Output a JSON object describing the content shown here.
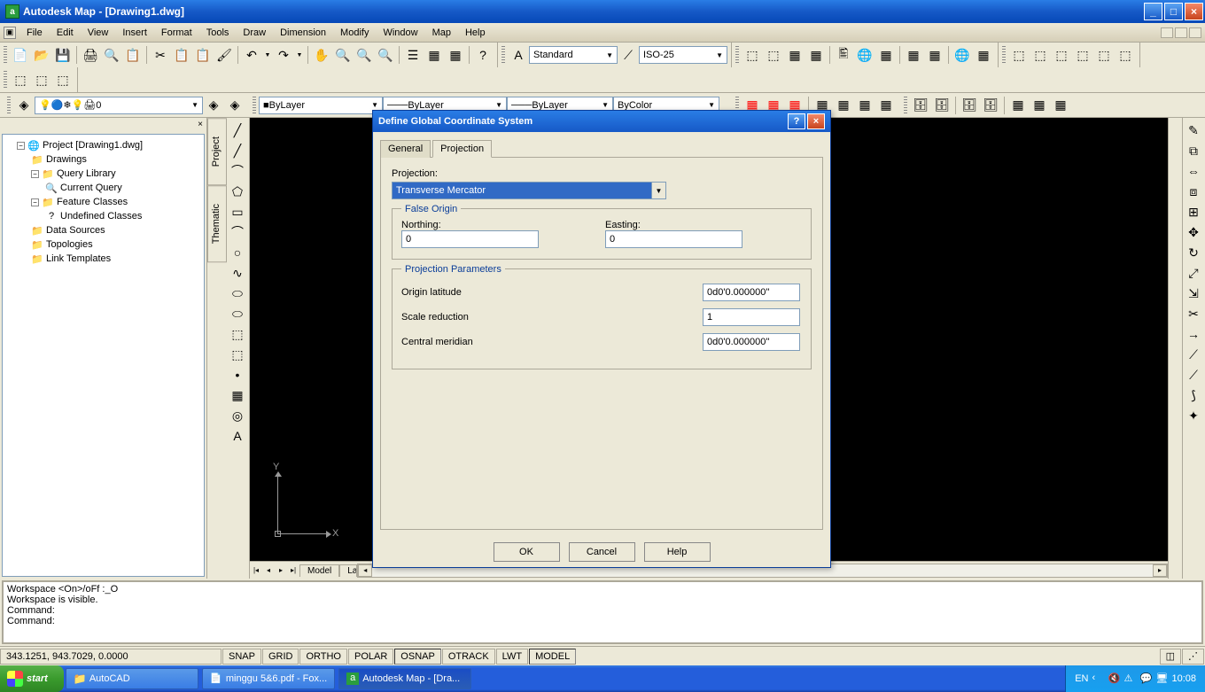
{
  "titlebar": {
    "title": "Autodesk Map - [Drawing1.dwg]"
  },
  "menubar": {
    "items": [
      "File",
      "Edit",
      "View",
      "Insert",
      "Format",
      "Tools",
      "Draw",
      "Dimension",
      "Modify",
      "Window",
      "Map",
      "Help"
    ]
  },
  "textstyle": {
    "select1": "Standard",
    "select2": "ISO-25"
  },
  "layer_props": {
    "layer_select": "0",
    "color": "ByLayer",
    "ltype": "ByLayer",
    "lweight": "ByLayer",
    "plot": "ByColor"
  },
  "side_tabs": [
    "Project",
    "Thematic"
  ],
  "tree": {
    "root": "Project [Drawing1.dwg]",
    "items": [
      "Drawings",
      "Query Library",
      "Current Query",
      "Feature Classes",
      "Undefined Classes",
      "Data Sources",
      "Topologies",
      "Link Templates"
    ]
  },
  "canvas": {
    "axis_y": "Y",
    "axis_x": "X"
  },
  "canvas_tabs": {
    "model": "Model",
    "layout": "La"
  },
  "dialog": {
    "title": "Define Global Coordinate System",
    "tabs": {
      "general": "General",
      "projection": "Projection"
    },
    "projection_label": "Projection:",
    "projection_value": "Transverse Mercator",
    "false_origin": {
      "legend": "False Origin",
      "northing_label": "Northing:",
      "northing_value": "0",
      "easting_label": "Easting:",
      "easting_value": "0"
    },
    "params": {
      "legend": "Projection Parameters",
      "origin_lat_label": "Origin latitude",
      "origin_lat_value": "0d0'0.000000''",
      "scale_label": "Scale reduction",
      "scale_value": "1",
      "meridian_label": "Central meridian",
      "meridian_value": "0d0'0.000000''"
    },
    "buttons": {
      "ok": "OK",
      "cancel": "Cancel",
      "help": "Help"
    }
  },
  "cmd": {
    "line1": "Workspace <On>/oFf :_O",
    "line2": "Workspace is visible.",
    "line3": "Command:",
    "line4": "Command:"
  },
  "statusbar": {
    "coords": "343.1251, 943.7029, 0.0000",
    "modes": [
      "SNAP",
      "GRID",
      "ORTHO",
      "POLAR",
      "OSNAP",
      "OTRACK",
      "LWT",
      "MODEL"
    ]
  },
  "taskbar": {
    "start": "start",
    "items": [
      "AutoCAD",
      "minggu 5&6.pdf - Fox...",
      "Autodesk Map - [Dra..."
    ],
    "lang": "EN",
    "time": "10:08"
  }
}
